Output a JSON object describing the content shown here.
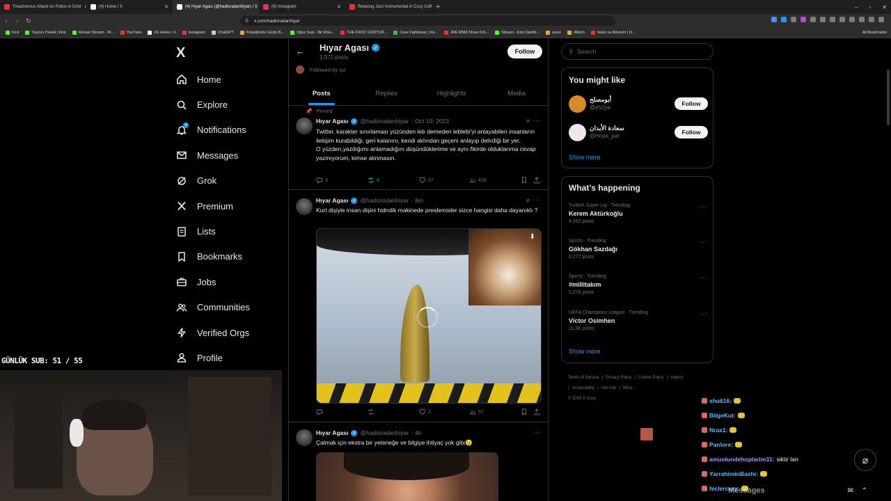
{
  "browser": {
    "tabs": [
      {
        "title": "Treacherous Attack on Police in İzmir",
        "color": "#ff2d2d"
      },
      {
        "title": "(4) Home / X",
        "color": "#ffffff"
      },
      {
        "title": "(4) Hıyar Agası (@hadioradanhiyar) / X",
        "color": "#ffffff",
        "active": true
      },
      {
        "title": "(9) Instagram",
        "color": "#e1306c"
      },
      {
        "title": "Relaxing Jazz Instrumental in Cozy Coffee Shop",
        "color": "#ff2d2d"
      }
    ],
    "url": "x.com/hadioradanhiyar",
    "bookmarks": [
      {
        "label": "Kick",
        "color": "#53fc18"
      },
      {
        "label": "Yayıncı Paneli | Kick",
        "color": "#53fc18"
      },
      {
        "label": "ikinsan Stream - W...",
        "color": "#53fc18"
      },
      {
        "label": "YouTube",
        "color": "#ff2d2d"
      },
      {
        "label": "(4) Home / X",
        "color": "#ffffff"
      },
      {
        "label": "Instagram",
        "color": "#e1306c"
      },
      {
        "label": "ChatGPT",
        "color": "#cccccc"
      },
      {
        "label": "Köpeğinizle Güçlü B...",
        "color": "#e7a33e"
      },
      {
        "label": "Oğuz Sasi - Bir Efsa...",
        "color": "#53fc18"
      },
      {
        "label": "THE FIRST GOKTUR...",
        "color": "#ff2d2d"
      },
      {
        "label": "Cave Fightwear | Ins...",
        "color": "#4caf50"
      },
      {
        "label": "JRE MMA Show #16...",
        "color": "#ff2d2d"
      },
      {
        "label": "Stream - Kick Dashb...",
        "color": "#53fc18"
      },
      {
        "label": "yeyın",
        "color": "#e7a33e"
      },
      {
        "label": "Albüm",
        "color": "#e7a33e"
      },
      {
        "label": "Islam vs Atheism | O...",
        "color": "#ff2d2d"
      }
    ],
    "all_bookmarks": "All Bookmarks"
  },
  "nav": {
    "logo": "X",
    "items": [
      {
        "label": "Home",
        "icon": "home-icon"
      },
      {
        "label": "Explore",
        "icon": "search-icon"
      },
      {
        "label": "Notifications",
        "icon": "bell-icon",
        "badge": "4"
      },
      {
        "label": "Messages",
        "icon": "envelope-icon"
      },
      {
        "label": "Grok",
        "icon": "grok-icon"
      },
      {
        "label": "Premium",
        "icon": "x-icon"
      },
      {
        "label": "Lists",
        "icon": "list-icon"
      },
      {
        "label": "Bookmarks",
        "icon": "bookmark-icon"
      },
      {
        "label": "Jobs",
        "icon": "briefcase-icon"
      },
      {
        "label": "Communities",
        "icon": "people-icon"
      },
      {
        "label": "Verified Orgs",
        "icon": "lightning-icon"
      },
      {
        "label": "Profile",
        "icon": "person-icon"
      }
    ]
  },
  "overlay": {
    "sub_counter": "GÜNLÜK SUB: 51 / 55"
  },
  "profile": {
    "name": "Hıyar Agası",
    "posts": "1,972 posts",
    "follow": "Follow",
    "followed_by": "Followed by ışıl",
    "tabs": [
      "Posts",
      "Replies",
      "Highlights",
      "Media"
    ]
  },
  "tweets": [
    {
      "pinned": "Pinned",
      "name": "Hıyar Agası",
      "handle": "@hadioradanhiyar",
      "time": "· Oct 10, 2023",
      "text": "Twitter, karakter sınırlaması yüzünden leb demeden leblebi'yi anlayabilen insanların iletişim kurabildiği, geri kalanını, kendi aklından geçeni anlayıp delirdiği bir yer.",
      "text2": "O yüzden,yazdığımı anlamadığını düşündüklerime ve aynı fikirde olduklarıma cevap yazmıyorum, kimse alınmasın.",
      "replies": "3",
      "reposts": "6",
      "likes": "37",
      "views": "41K"
    },
    {
      "name": "Hıyar Agası",
      "handle": "@hadioradanhiyar",
      "time": "· 6m",
      "text": "Kurt dişiyle insan dişini hidrolik makinede preslemisler sizce hangisi daha dayanıklı ?",
      "replies": "",
      "reposts": "",
      "likes": "2",
      "views": "57"
    },
    {
      "name": "Hıyar Agası",
      "handle": "@hadioradanhiyar",
      "time": "· 4h",
      "text": "Çalmak için ekstra bir yeteneğe ve bilgiye ihtiyaç yok gibi😉"
    }
  ],
  "sidebar": {
    "search_placeholder": "Search",
    "you_might_like": "You might like",
    "suggestions": [
      {
        "name": "أبومصلح",
        "handle": "@yh2ya",
        "follow": "Follow",
        "color": "#d88a2a"
      },
      {
        "name": "سعادة الأبدان",
        "handle": "@Hope_par",
        "follow": "Follow",
        "color": "#f2e6ee"
      }
    ],
    "show_more": "Show more",
    "whats_happening": "What’s happening",
    "trends": [
      {
        "category": "Turkish Super Lig · Trending",
        "name": "Kerem Aktürkoğlu",
        "count": "4,262 posts"
      },
      {
        "category": "Sports · Trending",
        "name": "Gökhan Sazdağı",
        "count": "6,277 posts"
      },
      {
        "category": "Sports · Trending",
        "name": "#millitakım",
        "count": "5,078 posts"
      },
      {
        "category": "UEFA Champions League · Trending",
        "name": "Victor Osimhen",
        "count": "11.8K posts"
      }
    ],
    "show_more2": "Show more",
    "footer": [
      "Terms of Service",
      "|",
      "Privacy Policy",
      "|",
      "Cookie Policy",
      "|",
      "Imprint",
      "|",
      "Accessibility",
      "|",
      "Ads info",
      "|",
      "More ···",
      "© 2025 X Corp."
    ]
  },
  "chat": [
    {
      "user": "shu616:",
      "msg": "",
      "color": "#5fb6ff",
      "emote": true
    },
    {
      "user": "BilgeKut:",
      "msg": "",
      "color": "#5fb6ff",
      "emote": true
    },
    {
      "user": "Nrax1:",
      "msg": "",
      "color": "#5fb6ff",
      "emote": true
    },
    {
      "user": "Panlore:",
      "msg": "",
      "color": "#5fb6ff",
      "emote": true
    },
    {
      "user": "amustundehoplarim31:",
      "msg": "siktir lan",
      "color": "#b48cff",
      "emote": false
    },
    {
      "user": "YarrahiminBashi:",
      "msg": "",
      "color": "#5fb6ff",
      "emote": true
    },
    {
      "user": "feclercury:",
      "msg": "",
      "color": "#5fb6ff",
      "emote": true
    }
  ],
  "messages_drawer": "Messages"
}
